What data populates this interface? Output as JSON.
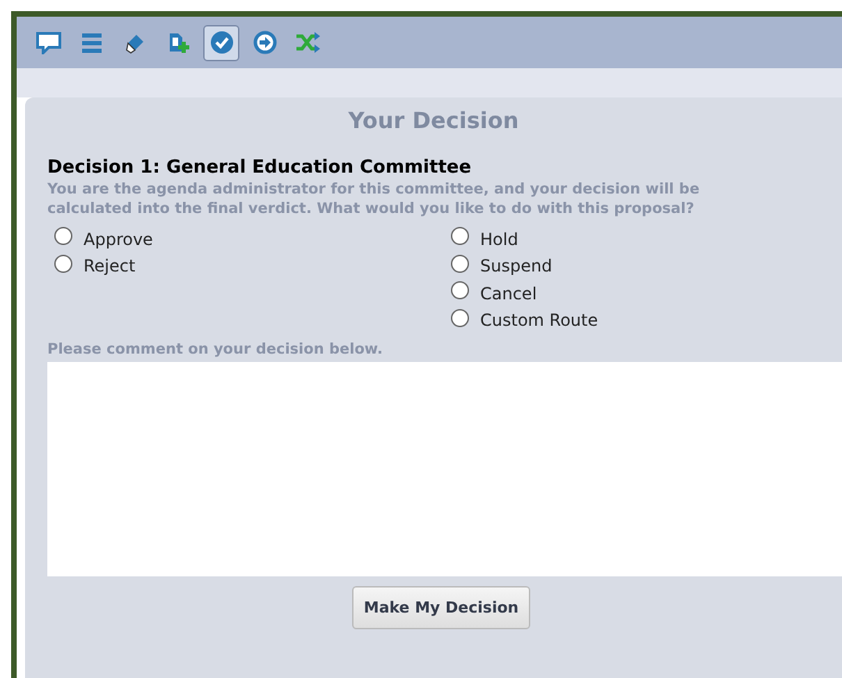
{
  "toolbar": [
    {
      "kind": "comment",
      "selected": false
    },
    {
      "kind": "list",
      "selected": false
    },
    {
      "kind": "eraser",
      "selected": false
    },
    {
      "kind": "add-page",
      "selected": false
    },
    {
      "kind": "check",
      "selected": true
    },
    {
      "kind": "forward",
      "selected": false
    },
    {
      "kind": "shuffle",
      "selected": false
    }
  ],
  "panel": {
    "title": "Your Decision",
    "heading": "Decision 1: General Education Committee",
    "description": "You are the agenda administrator for this committee, and your decision will be calculated into the final verdict. What would you like to do with this proposal?",
    "options_left": [
      {
        "label": "Approve",
        "checked": false
      },
      {
        "label": "Reject",
        "checked": false
      }
    ],
    "options_right": [
      {
        "label": "Hold",
        "checked": false
      },
      {
        "label": "Suspend",
        "checked": false
      },
      {
        "label": "Cancel",
        "checked": false
      },
      {
        "label": "Custom Route",
        "checked": false
      }
    ],
    "comment_label": "Please comment on your decision below.",
    "submit": "Make My Decision"
  }
}
